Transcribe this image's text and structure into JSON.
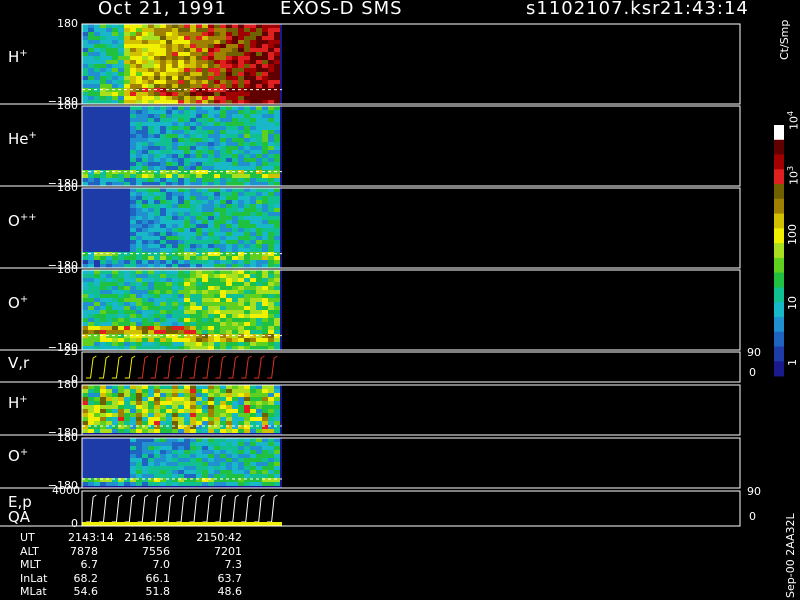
{
  "title": {
    "date": "Oct 21, 1991",
    "instrument": "EXOS-D SMS",
    "file": "s1102107.ksr",
    "time": "21:43:14"
  },
  "side_stamp": "Sep-00 2AA32L",
  "colorbar": {
    "label": "Ct/Smp",
    "ticks": [
      "1",
      "10",
      "100",
      "10^3",
      "10^4"
    ],
    "colors": [
      "#1a1a8c",
      "#1e3ca8",
      "#1f64c0",
      "#2090d0",
      "#18b8c8",
      "#10c090",
      "#20c040",
      "#60d020",
      "#a8e020",
      "#f0f000",
      "#d0c000",
      "#a08000",
      "#706000",
      "#e02020",
      "#a00000",
      "#600000",
      "#ffffff"
    ]
  },
  "chart_data": {
    "type": "heatmap",
    "panels": [
      {
        "id": "h1",
        "species": "H",
        "sup": "+",
        "ymax": "180",
        "ymin": "−180"
      },
      {
        "id": "he",
        "species": "He",
        "sup": "+",
        "ymax": "180",
        "ymin": "−180"
      },
      {
        "id": "opp",
        "species": "O",
        "sup": "++",
        "ymax": "180",
        "ymin": "−180"
      },
      {
        "id": "op1",
        "species": "O",
        "sup": "+",
        "ymax": "180",
        "ymin": "−180"
      },
      {
        "id": "vr",
        "species": "V,r",
        "sup": "",
        "ymax": "25",
        "ymin": "0",
        "right_top": "90",
        "right_bottom": "0"
      },
      {
        "id": "h2",
        "species": "H",
        "sup": "+",
        "ymax": "180",
        "ymin": "−180"
      },
      {
        "id": "op2",
        "species": "O",
        "sup": "+",
        "ymax": "180",
        "ymin": "−180"
      },
      {
        "id": "ep",
        "species": "E,p",
        "species2": "QA",
        "sup": "",
        "ymax": "4000",
        "ymin": "0",
        "right_top": "90",
        "right_bottom": "0"
      }
    ]
  },
  "footer": {
    "rows": [
      {
        "label": "UT",
        "values": [
          "2143:14",
          "2146:58",
          "2150:42"
        ]
      },
      {
        "label": "ALT",
        "values": [
          "7878",
          "7556",
          "7201"
        ]
      },
      {
        "label": "MLT",
        "values": [
          "6.7",
          "7.0",
          "7.3"
        ]
      },
      {
        "label": "InLat",
        "values": [
          "68.2",
          "66.1",
          "63.7"
        ]
      },
      {
        "label": "MLat",
        "values": [
          "54.6",
          "51.8",
          "48.6"
        ]
      }
    ]
  }
}
